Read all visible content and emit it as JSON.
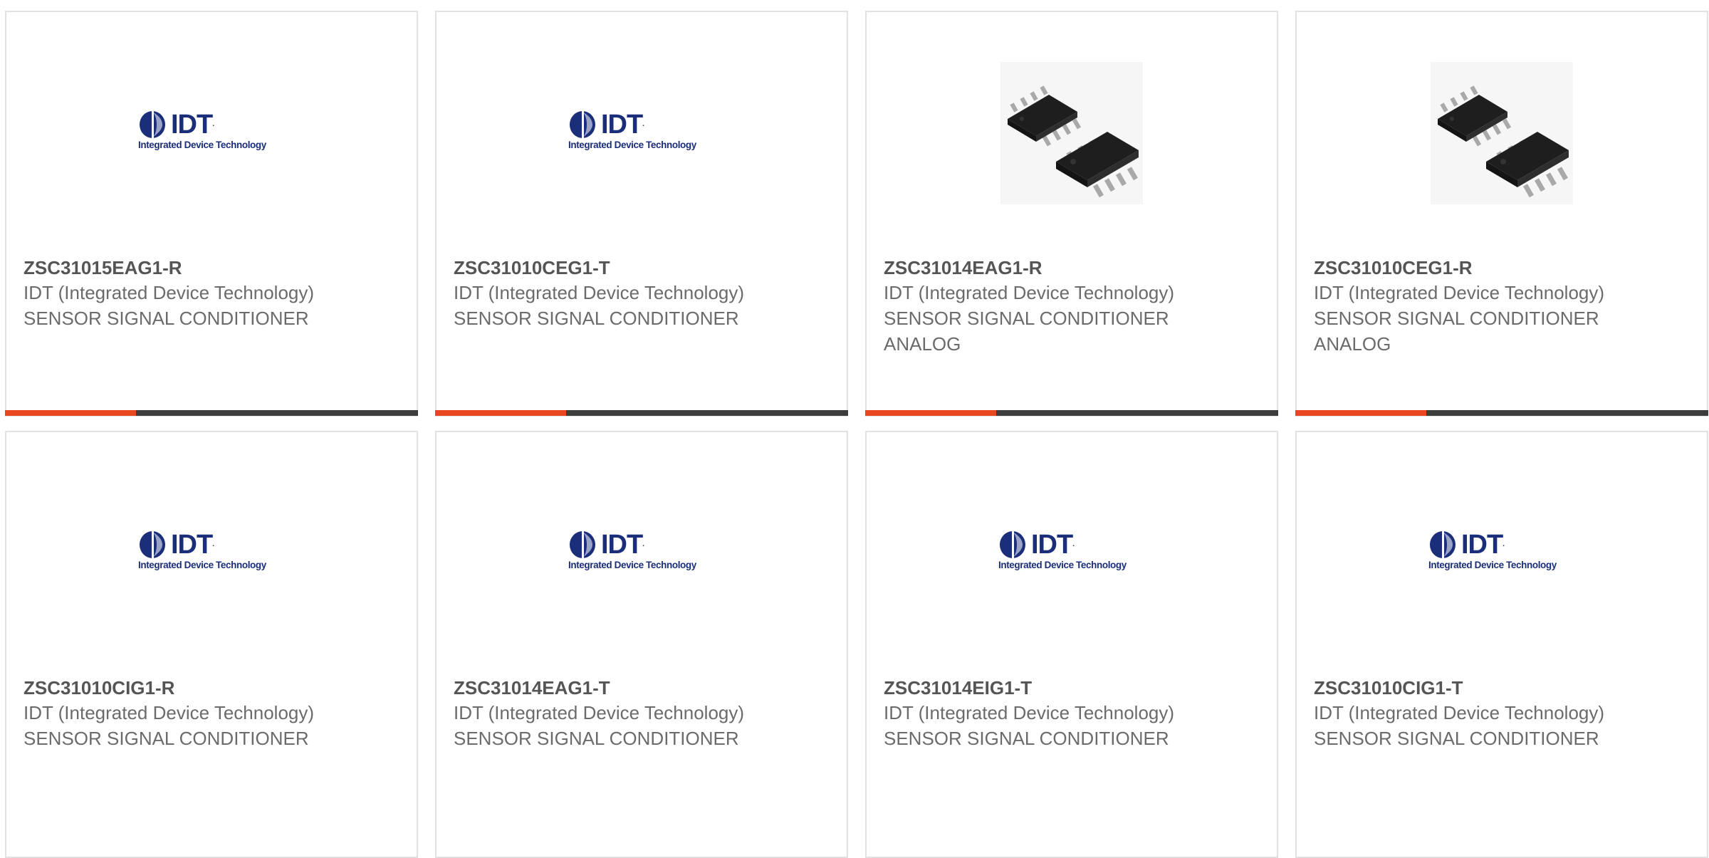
{
  "products": [
    {
      "part_no": "ZSC31015EAG1-R",
      "manufacturer": "IDT (Integrated Device Technology)",
      "description": "SENSOR SIGNAL CONDITIONER",
      "image": "idt-logo",
      "logo_text": "IDT",
      "logo_tagline": "Integrated Device Technology"
    },
    {
      "part_no": "ZSC31010CEG1-T",
      "manufacturer": "IDT (Integrated Device Technology)",
      "description": "SENSOR SIGNAL CONDITIONER",
      "image": "idt-logo",
      "logo_text": "IDT",
      "logo_tagline": "Integrated Device Technology"
    },
    {
      "part_no": "ZSC31014EAG1-R",
      "manufacturer": "IDT (Integrated Device Technology)",
      "description": "SENSOR SIGNAL CONDITIONER ANALOG",
      "image": "soic-chip-photo"
    },
    {
      "part_no": "ZSC31010CEG1-R",
      "manufacturer": "IDT (Integrated Device Technology)",
      "description": "SENSOR SIGNAL CONDITIONER ANALOG",
      "image": "soic-chip-photo"
    },
    {
      "part_no": "ZSC31010CIG1-R",
      "manufacturer": "IDT (Integrated Device Technology)",
      "description": "SENSOR SIGNAL CONDITIONER",
      "image": "idt-logo",
      "logo_text": "IDT",
      "logo_tagline": "Integrated Device Technology"
    },
    {
      "part_no": "ZSC31014EAG1-T",
      "manufacturer": "IDT (Integrated Device Technology)",
      "description": "SENSOR SIGNAL CONDITIONER",
      "image": "idt-logo",
      "logo_text": "IDT",
      "logo_tagline": "Integrated Device Technology"
    },
    {
      "part_no": "ZSC31014EIG1-T",
      "manufacturer": "IDT (Integrated Device Technology)",
      "description": "SENSOR SIGNAL CONDITIONER",
      "image": "idt-logo",
      "logo_text": "IDT",
      "logo_tagline": "Integrated Device Technology"
    },
    {
      "part_no": "ZSC31010CIG1-T",
      "manufacturer": "IDT (Integrated Device Technology)",
      "description": "SENSOR SIGNAL CONDITIONER",
      "image": "idt-logo",
      "logo_text": "IDT",
      "logo_tagline": "Integrated Device Technology"
    }
  ],
  "colors": {
    "accent": "#e8461e",
    "bar": "#3c3c3c",
    "border": "#e2e2e2",
    "part_no_text": "#555555",
    "body_text": "#6b6b6b",
    "logo_blue": "#1b2e7a"
  }
}
